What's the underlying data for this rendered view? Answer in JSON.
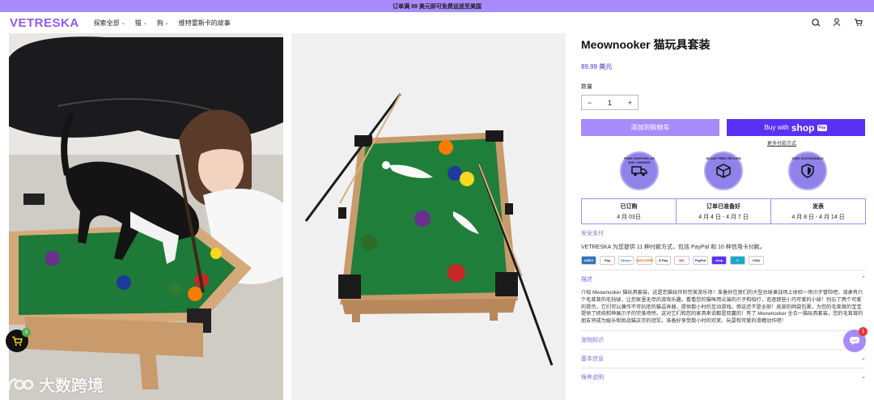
{
  "announcement": "订单满 99 美元即可免费运送至美国",
  "header": {
    "logo": "VETRESKA",
    "nav": [
      {
        "label": "探索全部",
        "has_menu": true
      },
      {
        "label": "猫",
        "has_menu": true
      },
      {
        "label": "狗",
        "has_menu": true
      },
      {
        "label": "维特雷斯卡的故事",
        "has_menu": false
      }
    ],
    "icons": [
      "currency-icon",
      "account-icon",
      "cart-icon"
    ]
  },
  "product": {
    "title": "Meownooker 猫玩具套装",
    "price": "89.99 美元",
    "qty_label": "数量",
    "qty_value": "1",
    "qty_minus": "−",
    "qty_plus": "+",
    "add_to_cart": "添加到购物车",
    "buy_with": "Buy with",
    "shop_word": "shop",
    "pay_badge": "Pay",
    "more_payment": "更多付款方式",
    "badges": [
      {
        "icon": "truck-icon",
        "text": "FREE SHIPPING ON $99+ ORDERS"
      },
      {
        "icon": "box-icon",
        "text": "30-DAY FREE RETURN"
      },
      {
        "icon": "shield-icon",
        "text": "100% SUSTAINABLE"
      }
    ],
    "timeline": [
      {
        "title": "已订购",
        "date": "4 月 03日"
      },
      {
        "title": "订单已准备好",
        "date": "4 月 4 日 - 4 月 7 日"
      },
      {
        "title": "发表",
        "date": "4 月 8 日 - 4 月 14 日"
      }
    ],
    "secure_checkout": "安全支付",
    "payment_note": "VETRESKA 为您提供 11 种付款方式，包括 PayPal 和 10 种信用卡付款。",
    "payment_methods": [
      "AMEX",
      "Pay",
      "Diners",
      "DISCOVER",
      "G Pay",
      "MC",
      "PayPal",
      "shop",
      "V",
      "VISA"
    ],
    "accordions": [
      {
        "label": "描述",
        "open": true
      },
      {
        "label": "宠物知识",
        "open": false
      },
      {
        "label": "基本信息",
        "open": false
      },
      {
        "label": "保养说明",
        "open": false
      }
    ],
    "description": "介绍 Meownooker 猫玩具套装，这是您猫玩伴的完美游乐场！准备好在我们的大型台球桌战场上体验一场爪子冒险吧，该桌有六个毛茸茸的毛毡球，让您家里无尽的游戏乐趣。看看您的猫咪用尖端的爪子和拍打，追逐那些小巧可爱的小球！别忘了两个可爱的提示，它们可以兼作不可抗拒的猫逗弄器，提供数小时的互动游戏。但这还不是全部！底部的网袋包裹，为您的毛茸茸的宝宝提供了抓挠和伸展爪子的完美场所。这对它们和您的家具来说都是双赢的！有了 Meownooker 全合一猫玩具套装，您的毛茸茸的朋友将成为娱乐和挑战猫正宗的冠军。准备好享受数小时的欢笑、玩耍和可爱的滑稽动作吧！"
  },
  "floating": {
    "cart_count": "0",
    "chat_count": "1"
  },
  "watermark": "大数跨境",
  "colors": {
    "accent": "#a78bfa",
    "shop_pay": "#5a31f4",
    "price": "#7c6fd6"
  }
}
